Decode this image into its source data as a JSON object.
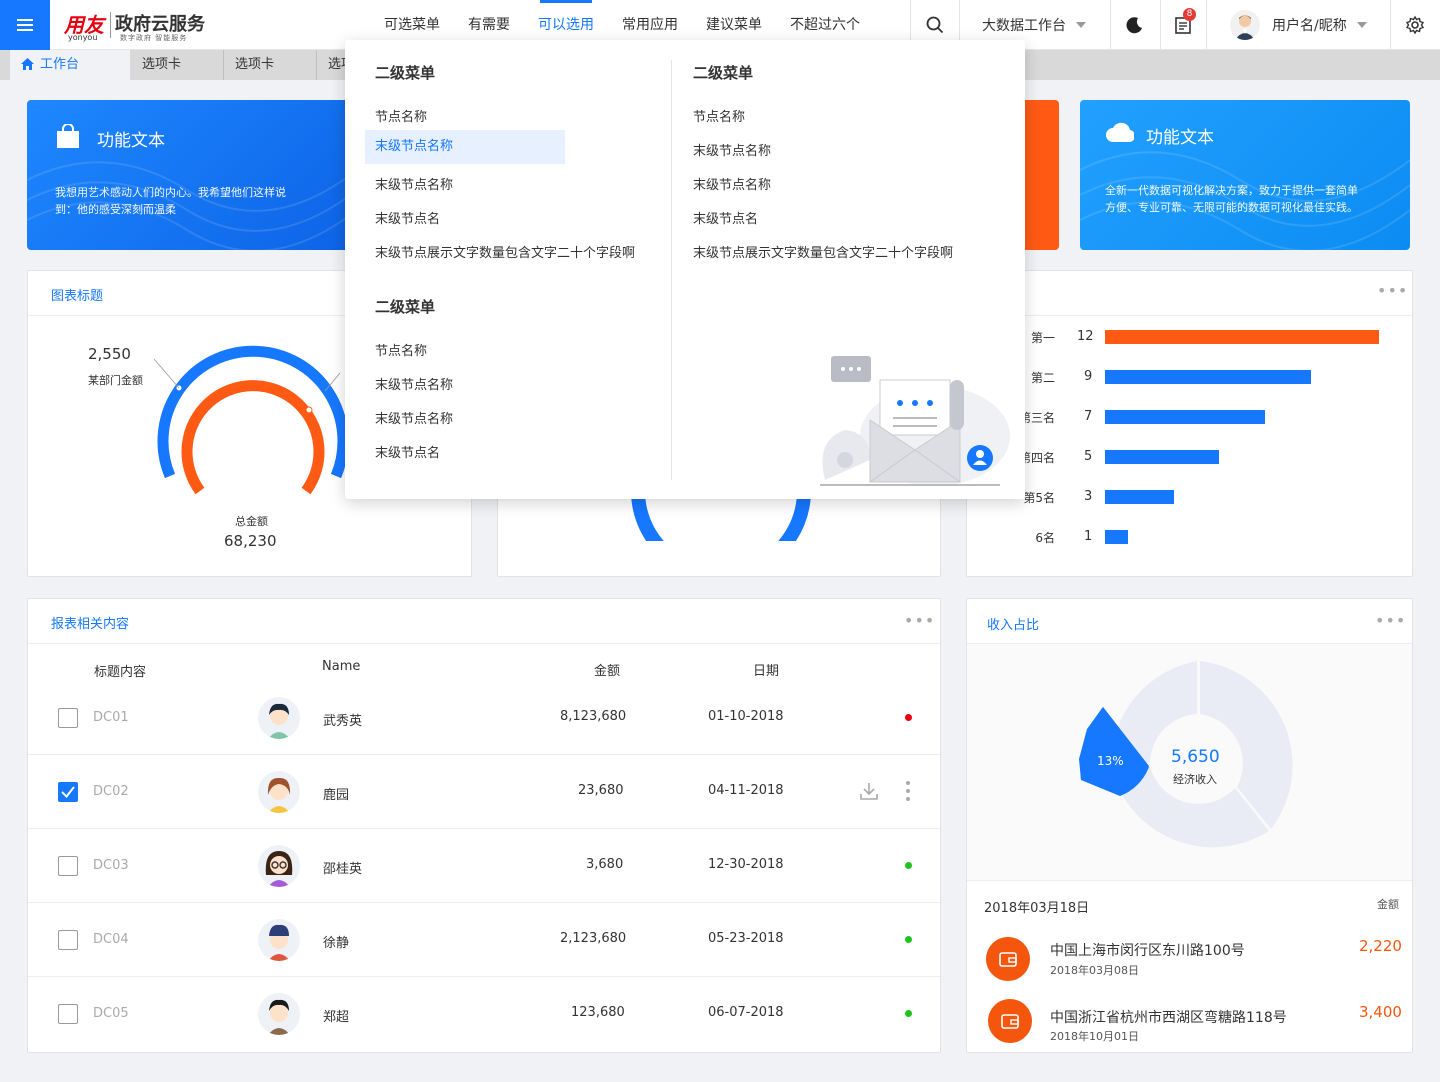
{
  "header": {
    "brand": "用友",
    "brand_sub": "yonyou",
    "product": "政府云服务",
    "slogan": "数字政府 智能服务",
    "nav": [
      "可选菜单",
      "有需要",
      "可以选用",
      "常用应用",
      "建议菜单",
      "不超过六个"
    ],
    "active_nav": "可以选用",
    "workspace": "大数据工作台",
    "notifications": "8",
    "username": "用户名/昵称"
  },
  "tabs": {
    "home": "工作台",
    "items": [
      "选项卡",
      "选项卡",
      "选项卡"
    ]
  },
  "banners": [
    {
      "title": "功能文本",
      "desc_line1": "我想用艺术感动人们的内心。我希望他们这样说",
      "desc_line2": "到：他的感受深刻而温柔",
      "color": "#1677ff"
    },
    {
      "title": "功能文本",
      "desc_line1": "全新一代数据可视化解决方案，致力于提供一套简单",
      "desc_line2": "方便、专业可靠、无限可能的数据可视化最佳实践。",
      "color": "#1890ff"
    }
  ],
  "gauge_card": {
    "title": "图表标题",
    "dept_value": "2,550",
    "dept_label": "某部门金额",
    "total_label": "总金额",
    "total_value": "68,230"
  },
  "ranking": {
    "items": [
      {
        "label": "第一",
        "value": 12,
        "color": "#ff5a14"
      },
      {
        "label": "第二",
        "value": 9,
        "color": "#1677ff"
      },
      {
        "label": "第三名",
        "value": 7,
        "color": "#1677ff"
      },
      {
        "label": "第四名",
        "value": 5,
        "color": "#1677ff"
      },
      {
        "label": "第5名",
        "value": 3,
        "color": "#1677ff"
      },
      {
        "label": "6名",
        "value": 1,
        "color": "#1677ff"
      }
    ]
  },
  "report": {
    "title": "报表相关内容",
    "headers": {
      "col1": "标题内容",
      "col2": "Name",
      "col3": "金额",
      "col4": "日期"
    },
    "rows": [
      {
        "code": "DC01",
        "name": "武秀英",
        "amount": "8,123,680",
        "date": "01-10-2018",
        "checked": false,
        "status": "#e60012"
      },
      {
        "code": "DC02",
        "name": "鹿园",
        "amount": "23,680",
        "date": "04-11-2018",
        "checked": true,
        "status": ""
      },
      {
        "code": "DC03",
        "name": "邵桂英",
        "amount": "3,680",
        "date": "12-30-2018",
        "checked": false,
        "status": "#1ec31e"
      },
      {
        "code": "DC04",
        "name": "徐静",
        "amount": "2,123,680",
        "date": "05-23-2018",
        "checked": false,
        "status": "#1ec31e"
      },
      {
        "code": "DC05",
        "name": "郑超",
        "amount": "123,680",
        "date": "06-07-2018",
        "checked": false,
        "status": "#1ec31e"
      }
    ]
  },
  "income": {
    "title": "收入占比",
    "center_value": "5,650",
    "center_label": "经济收入",
    "highlight_pct": "13%",
    "date": "2018年03月18日",
    "amount_label": "金额",
    "items": [
      {
        "title": "中国上海市闵行区东川路100号",
        "date": "2018年03月08日",
        "amount": "2,220"
      },
      {
        "title": "中国浙江省杭州市西湖区弯糖路118号",
        "date": "2018年10月01日",
        "amount": "3,400"
      }
    ]
  },
  "mega_menu": {
    "left_group1_title": "二级菜单",
    "left_group1_items": [
      "节点名称",
      "末级节点名称",
      "末级节点名称",
      "末级节点名",
      "末级节点展示文字数量包含文字二十个字段啊"
    ],
    "left_group2_title": "二级菜单",
    "left_group2_items": [
      "节点名称",
      "末级节点名称",
      "末级节点名称",
      "末级节点名"
    ],
    "right_group_title": "二级菜单",
    "right_group_items": [
      "节点名称",
      "末级节点名称",
      "末级节点名称",
      "末级节点名",
      "末级节点展示文字数量包含文字二十个字段啊"
    ]
  },
  "colors": {
    "accent": "#1677ff",
    "orange": "#ff5a14"
  }
}
